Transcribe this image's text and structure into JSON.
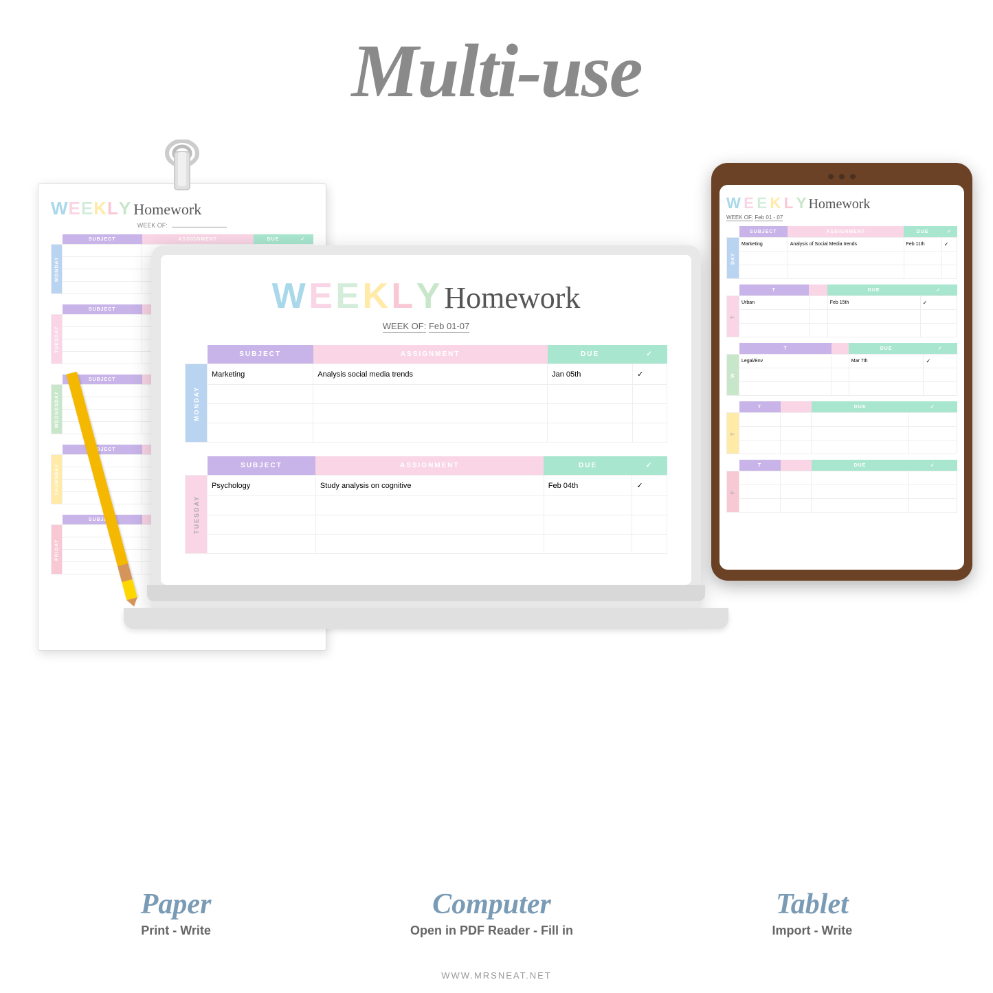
{
  "title": "Multi-use",
  "paper": {
    "weekly": "WEEKLY",
    "homework": "Homework",
    "week_of_label": "WEEK OF:",
    "week_of_value": "",
    "weekly_letters": [
      "W",
      "E",
      "E",
      "K",
      "L",
      "Y"
    ],
    "columns": [
      "SUBJECT",
      "ASSIGNMENT",
      "DUE",
      "✓"
    ],
    "days": [
      {
        "label": "MONDAY",
        "rows": 4
      },
      {
        "label": "TUESDAY",
        "rows": 4
      },
      {
        "label": "WEDNESDAY",
        "rows": 4
      },
      {
        "label": "THURSDAY",
        "rows": 4
      },
      {
        "label": "FRIDAY",
        "rows": 4
      }
    ]
  },
  "laptop": {
    "weekly": "WEEKLY",
    "homework": "Homework",
    "weekly_letters": [
      "W",
      "E",
      "E",
      "K",
      "L",
      "Y"
    ],
    "week_of_label": "WEEK OF:",
    "week_of_value": "Feb 01-07",
    "monday": {
      "day": "MONDAY",
      "subject": "Marketing",
      "assignment": "Analysis social media trends",
      "due": "Jan 05th",
      "check": "✓"
    },
    "tuesday": {
      "day": "TUESDAY",
      "subject": "Psychology",
      "assignment": "Study analysis on cognitive",
      "due": "Feb 04th",
      "check": "✓"
    },
    "columns": [
      "SUBJECT",
      "ASSIGNMENT",
      "DUE",
      "✓"
    ]
  },
  "tablet": {
    "weekly": "WEEKLY",
    "homework": "Homework",
    "weekly_letters": [
      "W",
      "E",
      "E",
      "K",
      "L",
      "Y"
    ],
    "week_of_label": "WEEK OF:",
    "week_of_value": "Feb 01 - 07",
    "monday_subject": "Marketing",
    "monday_assignment": "Analysis of Social Media trends",
    "monday_due": "Feb 11th",
    "tuesday_subject": "Urban",
    "tuesday_due": "Feb 15th",
    "wednesday_subject": "Legal/Env",
    "wednesday_due": "Mar 7th",
    "columns": [
      "SUBJECT",
      "ASSIGNMENT",
      "DUE",
      "✓"
    ]
  },
  "bottom": {
    "paper_title": "Paper",
    "paper_sub": "Print - Write",
    "computer_title": "Computer",
    "computer_sub": "Open in PDF Reader - Fill in",
    "tablet_title": "Tablet",
    "tablet_sub": "Import - Write",
    "website": "WWW.MRSNEAT.NET"
  }
}
